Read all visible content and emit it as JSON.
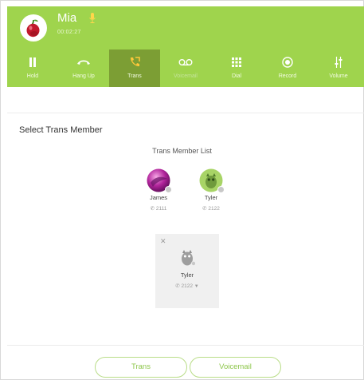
{
  "caller": {
    "name": "Mia",
    "timer": "00:02:27"
  },
  "toolbar": [
    {
      "label": "Hold",
      "icon": "pause-icon",
      "state": "normal"
    },
    {
      "label": "Hang Up",
      "icon": "phone-hangup-icon",
      "state": "normal"
    },
    {
      "label": "Trans",
      "icon": "phone-transfer-icon",
      "state": "active"
    },
    {
      "label": "Voicemail",
      "icon": "voicemail-icon",
      "state": "disabled"
    },
    {
      "label": "Dial",
      "icon": "dialpad-icon",
      "state": "normal"
    },
    {
      "label": "Record",
      "icon": "record-icon",
      "state": "normal"
    },
    {
      "label": "Volume",
      "icon": "volume-sliders-icon",
      "state": "normal"
    }
  ],
  "trans": {
    "section_title": "Select Trans Member",
    "list_title": "Trans Member List",
    "members": [
      {
        "name": "James",
        "ext": "2111"
      },
      {
        "name": "Tyler",
        "ext": "2122"
      }
    ],
    "selected": {
      "name": "Tyler",
      "ext": "2122",
      "close_icon": "close-icon",
      "dropdown_icon": "caret-down-icon"
    }
  },
  "buttons": {
    "trans": "Trans",
    "voicemail": "Voicemail"
  },
  "colors": {
    "accent_green": "#9fd44d",
    "active_tab": "#7c9e34",
    "button_text": "#8dc64a"
  }
}
